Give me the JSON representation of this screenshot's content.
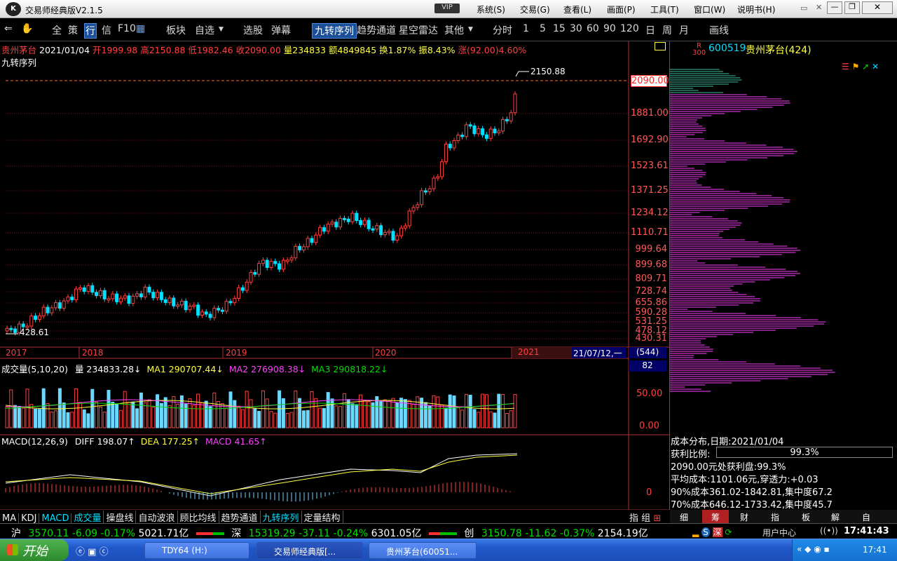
{
  "window": {
    "title": "交易师经典版V2.1.5",
    "vip_label": "VIP",
    "menus": [
      "系统(S)",
      "交易(G)",
      "查看(L)",
      "画面(P)",
      "工具(T)",
      "窗口(W)",
      "说明书(H)"
    ]
  },
  "toolbar": {
    "items": [
      "全",
      "策",
      "行",
      "信",
      "F10",
      "板块",
      "自选",
      "选股",
      "弹幕",
      "九转序列",
      "趋势通道",
      "星空雷达",
      "其他",
      "分时",
      "1",
      "5",
      "15",
      "30",
      "60",
      "90",
      "120",
      "日",
      "周",
      "月",
      "画线"
    ]
  },
  "header": {
    "name": "贵州茅台",
    "date": "2021/01/04",
    "open": "开1999.98",
    "high": "高2150.88",
    "low": "低1982.46",
    "close": "收2090.00",
    "volume": "量234833",
    "amount": "额4849845",
    "turnover": "换1.87%",
    "amplitude": "振8.43%",
    "change": "涨(92.00)4.60%",
    "indicator": "九转序列"
  },
  "price_axis": [
    "2090.00",
    "1881.00",
    "1692.90",
    "1523.61",
    "1371.25",
    "1234.12",
    "1110.71",
    "999.64",
    "899.68",
    "809.71",
    "728.74",
    "655.86",
    "590.28",
    "531.25",
    "478.12",
    "430.31"
  ],
  "annotations": {
    "high": "2150.88",
    "low": "428.61"
  },
  "years": [
    "2017",
    "2018",
    "2019",
    "2020",
    "2021"
  ],
  "cursor_date": "21/07/12,一",
  "count": "(544)",
  "count2": "82",
  "volume_panel": {
    "title": "成交量(5,10,20)",
    "vol": "量 234833.28↓",
    "ma1": "MA1 290707.44↓",
    "ma2": "MA2 276908.38↓",
    "ma3": "MA3 290818.22↓",
    "axis": [
      "50.00",
      "0.00"
    ]
  },
  "macd_panel": {
    "title": "MACD(12,26,9)",
    "diff": "DIFF 198.07↑",
    "dea": "DEA 177.25↑",
    "macd": "MACD 41.65↑",
    "axis": "0"
  },
  "bottom_tabs": [
    "MA",
    "KDJ",
    "MACD",
    "成交量",
    "操盘线",
    "自动波浪",
    "顾比均线",
    "趋势通道",
    "九转序列",
    "定量结构"
  ],
  "bottom_right": [
    "指",
    "组"
  ],
  "right_panel": {
    "rank": "300",
    "code": "600519",
    "name": "贵州茅台(424)",
    "cost_title": "成本分布,日期:2021/01/04",
    "profit_label": "获利比例:",
    "profit_value": "99.3%",
    "line1": "2090.00元处获利盘:99.3%",
    "line2": "平均成本:1101.06元,穿透力:+0.03",
    "line3": "90%成本361.02-1842.81,集中度67.2",
    "line4": "70%成本646.12-1733.42,集中度45.7",
    "tabs": [
      "细",
      "筹",
      "财",
      "指",
      "板",
      "解",
      "自"
    ]
  },
  "status": {
    "sh_label": "沪",
    "sh_index": "3570.11",
    "sh_chg": "-6.09",
    "sh_pct": "-0.17%",
    "sh_amt": "5021.71亿",
    "sz_label": "深",
    "sz_index": "15319.29",
    "sz_chg": "-37.11",
    "sz_pct": "-0.24%",
    "sz_amt": "6301.05亿",
    "cy_label": "创",
    "cy_index": "3150.78",
    "cy_chg": "-11.62",
    "cy_pct": "-0.37%",
    "cy_amt": "2154.19亿",
    "user_center": "用户中心",
    "time": "17:41:43"
  },
  "taskbar": {
    "start": "开始",
    "tasks": [
      "TDY64 (H:)",
      "交易师经典版[...",
      "贵州茅台(60051..."
    ],
    "clock": "17:41"
  },
  "colors": {
    "up": "#ff4040",
    "down": "#00e0ff",
    "bg": "#000000",
    "magenta": "#ff40ff"
  }
}
